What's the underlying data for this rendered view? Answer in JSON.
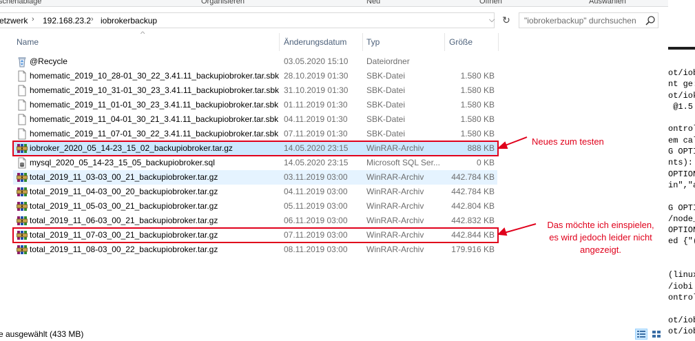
{
  "ribbon": {
    "groups": [
      "schenablage",
      "Organisieren",
      "Neu",
      "Öffnen",
      "Auswählen"
    ]
  },
  "address": {
    "crumbs": [
      "etzwerk",
      "192.168.23.2",
      "iobrokerbackup"
    ],
    "dropdown_icon": "chevron-down-icon",
    "refresh_icon": "refresh-icon"
  },
  "search": {
    "placeholder": "\"iobrokerbackup\" durchsuchen",
    "icon": "search-icon"
  },
  "columns": {
    "name": "Name",
    "date": "Änderungsdatum",
    "type": "Typ",
    "size": "Größe",
    "sorted_by": "Name"
  },
  "files": [
    {
      "name": "@Recycle",
      "date": "03.05.2020 15:10",
      "type": "Dateiordner",
      "size": "",
      "icon": "recycle-folder-icon",
      "state": "none"
    },
    {
      "name": "homematic_2019_10_28-01_30_22_3.41.11_backupiobroker.tar.sbk",
      "date": "28.10.2019 01:30",
      "type": "SBK-Datei",
      "size": "1.580 KB",
      "icon": "file-icon",
      "state": "none"
    },
    {
      "name": "homematic_2019_10_31-01_30_23_3.41.11_backupiobroker.tar.sbk",
      "date": "31.10.2019 01:30",
      "type": "SBK-Datei",
      "size": "1.580 KB",
      "icon": "file-icon",
      "state": "none"
    },
    {
      "name": "homematic_2019_11_01-01_30_23_3.41.11_backupiobroker.tar.sbk",
      "date": "01.11.2019 01:30",
      "type": "SBK-Datei",
      "size": "1.580 KB",
      "icon": "file-icon",
      "state": "none"
    },
    {
      "name": "homematic_2019_11_04-01_30_21_3.41.11_backupiobroker.tar.sbk",
      "date": "04.11.2019 01:30",
      "type": "SBK-Datei",
      "size": "1.580 KB",
      "icon": "file-icon",
      "state": "none"
    },
    {
      "name": "homematic_2019_11_07-01_30_22_3.41.11_backupiobroker.tar.sbk",
      "date": "07.11.2019 01:30",
      "type": "SBK-Datei",
      "size": "1.580 KB",
      "icon": "file-icon",
      "state": "none"
    },
    {
      "name": "iobroker_2020_05_14-23_15_02_backupiobroker.tar.gz",
      "date": "14.05.2020 23:15",
      "type": "WinRAR-Archiv",
      "size": "888 KB",
      "icon": "winrar-archive-icon",
      "state": "selected"
    },
    {
      "name": "mysql_2020_05_14-23_15_05_backupiobroker.sql",
      "date": "14.05.2020 23:15",
      "type": "Microsoft SQL Ser...",
      "size": "0 KB",
      "icon": "sql-file-icon",
      "state": "none"
    },
    {
      "name": "total_2019_11_03-03_00_21_backupiobroker.tar.gz",
      "date": "03.11.2019 03:00",
      "type": "WinRAR-Archiv",
      "size": "442.784 KB",
      "icon": "winrar-archive-icon",
      "state": "hover"
    },
    {
      "name": "total_2019_11_04-03_00_20_backupiobroker.tar.gz",
      "date": "04.11.2019 03:00",
      "type": "WinRAR-Archiv",
      "size": "442.784 KB",
      "icon": "winrar-archive-icon",
      "state": "none"
    },
    {
      "name": "total_2019_11_05-03_00_21_backupiobroker.tar.gz",
      "date": "05.11.2019 03:00",
      "type": "WinRAR-Archiv",
      "size": "442.804 KB",
      "icon": "winrar-archive-icon",
      "state": "none"
    },
    {
      "name": "total_2019_11_06-03_00_21_backupiobroker.tar.gz",
      "date": "06.11.2019 03:00",
      "type": "WinRAR-Archiv",
      "size": "442.832 KB",
      "icon": "winrar-archive-icon",
      "state": "none"
    },
    {
      "name": "total_2019_11_07-03_00_21_backupiobroker.tar.gz",
      "date": "07.11.2019 03:00",
      "type": "WinRAR-Archiv",
      "size": "442.844 KB",
      "icon": "winrar-archive-icon",
      "state": "none"
    },
    {
      "name": "total_2019_11_08-03_00_22_backupiobroker.tar.gz",
      "date": "08.11.2019 03:00",
      "type": "WinRAR-Archiv",
      "size": "179.916 KB",
      "icon": "winrar-archive-icon",
      "state": "none"
    }
  ],
  "annotations": {
    "note_new": "Neues zum testen",
    "note_restore": [
      "Das möchte ich einspielen,",
      "es wird jedoch leider nicht",
      "angezeigt."
    ],
    "color": "#e0001b"
  },
  "terminal_lines": [
    "ot/iob",
    "nt ge:",
    "ot/iok",
    " @1.5",
    "",
    "ontrol",
    "em cal",
    "G OPTI",
    "nts):",
    "OPTION",
    "in\",\"a",
    "",
    "G OPTI",
    "/node_",
    "OPTION",
    "ed {\"(",
    "",
    "",
    "(linux",
    "/iobi",
    "ontrol",
    "",
    "ot/iob",
    "ot/iob"
  ],
  "status": {
    "text": "e ausgewählt (433 MB)",
    "views": [
      "details-view-icon",
      "tiles-view-icon"
    ]
  },
  "colors": {
    "selected_row": "#cce8ff",
    "hover_row": "#e5f3ff",
    "header_text": "#4c607a"
  }
}
